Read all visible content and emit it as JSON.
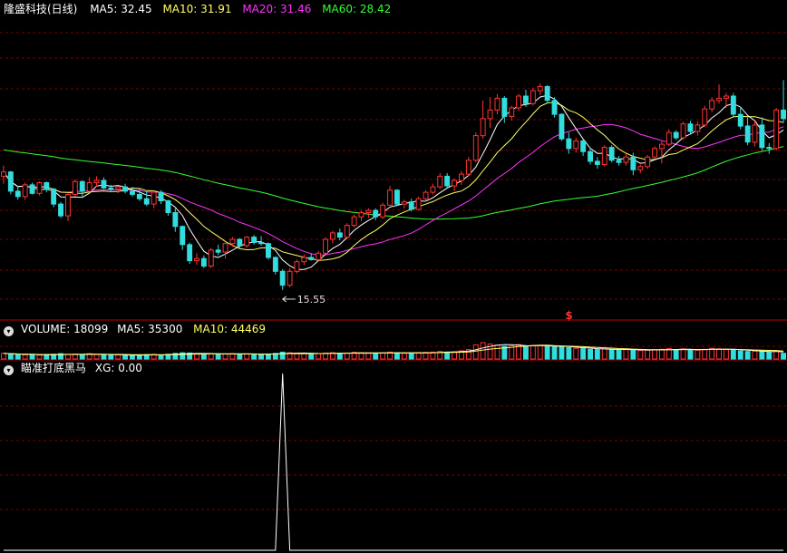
{
  "chart_data": [
    {
      "type": "candlestick",
      "title": "隆盛科技(日线)",
      "ma_labels": [
        {
          "name": "MA5",
          "value": "MA5: 32.45",
          "color": "#ffffff"
        },
        {
          "name": "MA10",
          "value": "MA10: 31.91",
          "color": "#ffff66"
        },
        {
          "name": "MA20",
          "value": "MA20: 31.46",
          "color": "#ff33ff"
        },
        {
          "name": "MA60",
          "value": "MA60: 28.42",
          "color": "#33ff33"
        }
      ],
      "ylim": [
        13,
        41
      ],
      "low_marker": "15.55",
      "marker_symbol": "$",
      "candles": [
        [
          26.2,
          27.2,
          25.5,
          26.6
        ],
        [
          26.6,
          26.7,
          24.5,
          24.8
        ],
        [
          24.8,
          25.3,
          24.0,
          24.3
        ],
        [
          24.3,
          25.6,
          24.0,
          25.4
        ],
        [
          25.4,
          25.6,
          24.5,
          24.6
        ],
        [
          24.6,
          25.7,
          24.4,
          25.6
        ],
        [
          25.6,
          25.7,
          24.7,
          25.0
        ],
        [
          25.0,
          25.1,
          23.3,
          23.6
        ],
        [
          23.6,
          23.8,
          22.3,
          22.5
        ],
        [
          22.5,
          24.6,
          22.0,
          24.5
        ],
        [
          24.5,
          25.9,
          24.3,
          25.7
        ],
        [
          25.7,
          25.8,
          24.3,
          24.8
        ],
        [
          24.8,
          26.1,
          24.7,
          25.6
        ],
        [
          25.6,
          26.2,
          25.2,
          25.8
        ],
        [
          25.8,
          26.1,
          25.0,
          25.1
        ],
        [
          25.1,
          25.4,
          24.7,
          25.0
        ],
        [
          25.0,
          25.3,
          24.6,
          25.2
        ],
        [
          25.2,
          25.5,
          24.6,
          24.8
        ],
        [
          24.8,
          25.2,
          24.3,
          24.5
        ],
        [
          24.5,
          25.0,
          23.9,
          24.1
        ],
        [
          24.1,
          24.8,
          23.4,
          23.6
        ],
        [
          23.6,
          24.9,
          23.2,
          24.7
        ],
        [
          24.7,
          24.9,
          23.6,
          23.9
        ],
        [
          23.9,
          24.0,
          22.5,
          22.8
        ],
        [
          22.8,
          23.2,
          21.0,
          21.5
        ],
        [
          21.5,
          21.6,
          19.3,
          19.8
        ],
        [
          19.8,
          20.0,
          18.0,
          18.3
        ],
        [
          18.3,
          19.0,
          17.9,
          18.5
        ],
        [
          18.5,
          18.8,
          17.6,
          17.8
        ],
        [
          17.8,
          19.5,
          17.6,
          19.3
        ],
        [
          19.3,
          19.8,
          18.8,
          19.1
        ],
        [
          19.1,
          20.0,
          18.5,
          19.9
        ],
        [
          19.9,
          20.5,
          19.6,
          20.3
        ],
        [
          20.3,
          20.4,
          19.5,
          19.7
        ],
        [
          19.7,
          20.6,
          19.5,
          20.5
        ],
        [
          20.5,
          20.7,
          19.8,
          20.0
        ],
        [
          20.0,
          20.6,
          19.7,
          19.9
        ],
        [
          19.9,
          20.0,
          18.4,
          18.6
        ],
        [
          18.6,
          18.7,
          17.0,
          17.3
        ],
        [
          17.3,
          17.5,
          15.55,
          16.0
        ],
        [
          16.0,
          17.6,
          15.8,
          17.3
        ],
        [
          17.3,
          18.4,
          17.1,
          18.2
        ],
        [
          18.2,
          18.9,
          17.9,
          18.6
        ],
        [
          18.6,
          19.0,
          18.3,
          18.4
        ],
        [
          18.4,
          19.2,
          18.2,
          19.0
        ],
        [
          19.0,
          20.5,
          18.8,
          20.3
        ],
        [
          20.3,
          21.1,
          19.9,
          20.9
        ],
        [
          20.9,
          21.3,
          20.2,
          20.5
        ],
        [
          20.5,
          21.8,
          20.3,
          21.6
        ],
        [
          21.6,
          22.6,
          21.4,
          22.4
        ],
        [
          22.4,
          23.0,
          22.0,
          22.8
        ],
        [
          22.8,
          23.2,
          22.3,
          23.0
        ],
        [
          23.0,
          23.2,
          22.1,
          22.4
        ],
        [
          22.4,
          23.7,
          22.2,
          23.5
        ],
        [
          23.5,
          25.3,
          23.4,
          24.9
        ],
        [
          24.9,
          25.0,
          23.4,
          23.6
        ],
        [
          23.6,
          24.0,
          23.2,
          23.8
        ],
        [
          23.8,
          24.1,
          22.9,
          23.1
        ],
        [
          23.1,
          24.3,
          23.0,
          24.1
        ],
        [
          24.1,
          24.9,
          23.8,
          24.7
        ],
        [
          24.7,
          25.5,
          24.5,
          25.2
        ],
        [
          25.2,
          26.5,
          25.0,
          26.2
        ],
        [
          26.2,
          26.5,
          25.1,
          25.3
        ],
        [
          25.3,
          26.0,
          24.8,
          25.8
        ],
        [
          25.8,
          26.7,
          25.4,
          26.4
        ],
        [
          26.4,
          28.0,
          26.2,
          27.7
        ],
        [
          27.7,
          30.3,
          27.5,
          30.0
        ],
        [
          30.0,
          33.3,
          29.7,
          31.6
        ],
        [
          31.6,
          33.6,
          30.7,
          32.4
        ],
        [
          32.4,
          33.9,
          32.0,
          33.5
        ],
        [
          33.5,
          33.7,
          31.2,
          31.8
        ],
        [
          31.8,
          32.8,
          31.4,
          32.6
        ],
        [
          32.6,
          33.9,
          32.3,
          33.7
        ],
        [
          33.7,
          34.3,
          32.7,
          33.0
        ],
        [
          33.0,
          34.5,
          32.8,
          34.2
        ],
        [
          34.2,
          34.9,
          33.8,
          34.6
        ],
        [
          34.6,
          34.7,
          33.0,
          33.3
        ],
        [
          33.3,
          33.6,
          31.7,
          32.0
        ],
        [
          32.0,
          32.1,
          29.5,
          29.7
        ],
        [
          29.7,
          30.3,
          28.3,
          28.8
        ],
        [
          28.8,
          29.8,
          28.4,
          29.5
        ],
        [
          29.5,
          29.7,
          28.1,
          28.5
        ],
        [
          28.5,
          28.9,
          27.3,
          27.6
        ],
        [
          27.6,
          28.0,
          26.9,
          27.3
        ],
        [
          27.3,
          29.1,
          27.1,
          28.9
        ],
        [
          28.9,
          29.1,
          27.5,
          27.7
        ],
        [
          27.7,
          28.1,
          27.2,
          27.5
        ],
        [
          27.5,
          28.3,
          27.2,
          28.0
        ],
        [
          28.0,
          28.4,
          26.3,
          26.8
        ],
        [
          26.8,
          27.3,
          26.5,
          27.1
        ],
        [
          27.1,
          28.2,
          26.9,
          28.0
        ],
        [
          28.0,
          29.0,
          27.8,
          28.8
        ],
        [
          28.8,
          29.5,
          27.4,
          29.2
        ],
        [
          29.2,
          30.6,
          29.0,
          30.3
        ],
        [
          30.3,
          30.5,
          29.6,
          29.8
        ],
        [
          29.8,
          31.3,
          29.6,
          31.1
        ],
        [
          31.1,
          31.4,
          30.2,
          30.4
        ],
        [
          30.4,
          31.3,
          30.0,
          31.0
        ],
        [
          31.0,
          32.8,
          30.8,
          32.5
        ],
        [
          32.5,
          33.6,
          32.2,
          33.3
        ],
        [
          33.3,
          34.8,
          33.0,
          33.5
        ],
        [
          33.5,
          34.0,
          32.6,
          33.7
        ],
        [
          33.7,
          34.0,
          31.8,
          32.0
        ],
        [
          32.0,
          32.6,
          30.6,
          30.9
        ],
        [
          30.9,
          31.7,
          29.1,
          29.4
        ],
        [
          29.4,
          31.3,
          29.0,
          31.0
        ],
        [
          31.0,
          31.7,
          28.6,
          28.9
        ],
        [
          28.9,
          29.3,
          28.3,
          28.8
        ],
        [
          28.8,
          32.6,
          28.6,
          32.4
        ],
        [
          32.4,
          35.2,
          31.2,
          31.6
        ]
      ]
    },
    {
      "type": "bar",
      "label": "VOLUME: 18099",
      "ma5_label": "MA5: 35300",
      "ma10_label": "MA10: 44469",
      "ylim": [
        0,
        75000
      ],
      "values": [
        18000,
        16000,
        14000,
        13000,
        14000,
        12000,
        13000,
        15000,
        17000,
        15000,
        16000,
        14000,
        17000,
        15000,
        13000,
        12000,
        13000,
        12000,
        12000,
        13000,
        14000,
        15000,
        13000,
        15000,
        18000,
        20000,
        19000,
        16000,
        15000,
        17000,
        15000,
        16000,
        17000,
        15000,
        16000,
        15000,
        14000,
        16000,
        18000,
        22000,
        20000,
        18000,
        17000,
        16000,
        17000,
        19000,
        20000,
        18000,
        19000,
        21000,
        20000,
        19000,
        18000,
        19000,
        22000,
        20000,
        18000,
        19000,
        20000,
        21000,
        22000,
        24000,
        22000,
        23000,
        26000,
        30000,
        45000,
        52000,
        48000,
        44000,
        40000,
        42000,
        46000,
        40000,
        42000,
        43000,
        41000,
        38000,
        40000,
        36000,
        34000,
        33000,
        31000,
        30000,
        32000,
        30000,
        29000,
        30000,
        29000,
        27000,
        28000,
        30000,
        31000,
        33000,
        30000,
        32000,
        29000,
        28000,
        31000,
        34000,
        32000,
        30000,
        28000,
        26000,
        24000,
        25000,
        23000,
        22000,
        26000,
        18099
      ]
    },
    {
      "type": "line",
      "label": "瞄准打底黑马",
      "value_label": "XG: 0.00",
      "ylim": [
        0,
        1
      ],
      "values": [
        0,
        0,
        0,
        0,
        0,
        0,
        0,
        0,
        0,
        0,
        0,
        0,
        0,
        0,
        0,
        0,
        0,
        0,
        0,
        0,
        0,
        0,
        0,
        0,
        0,
        0,
        0,
        0,
        0,
        0,
        0,
        0,
        0,
        0,
        0,
        0,
        0,
        0,
        0,
        1,
        0,
        0,
        0,
        0,
        0,
        0,
        0,
        0,
        0,
        0,
        0,
        0,
        0,
        0,
        0,
        0,
        0,
        0,
        0,
        0,
        0,
        0,
        0,
        0,
        0,
        0,
        0,
        0,
        0,
        0,
        0,
        0,
        0,
        0,
        0,
        0,
        0,
        0,
        0,
        0,
        0,
        0,
        0,
        0,
        0,
        0,
        0,
        0,
        0,
        0,
        0,
        0,
        0,
        0,
        0,
        0,
        0,
        0,
        0,
        0,
        0,
        0,
        0,
        0,
        0,
        0,
        0,
        0,
        0,
        0
      ]
    }
  ],
  "colors": {
    "up": "#ff3333",
    "down": "#33dddd",
    "grid": "#7a0000",
    "separator": "#c00000",
    "ma5": "#ffffff",
    "ma10": "#ffff66",
    "ma20": "#ff33ff",
    "ma60": "#33ff33",
    "indicator": "#ffffff",
    "marker": "#ff3333"
  }
}
